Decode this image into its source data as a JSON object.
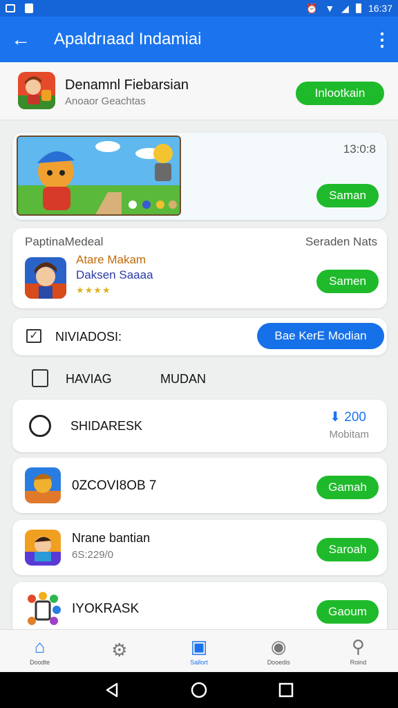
{
  "status_bar": {
    "time": "16:37"
  },
  "app_bar": {
    "title": "Apaldrıaad Indamiai"
  },
  "top_item": {
    "name": "Denamnl Fiebarsian",
    "subtitle": "Anoaor Geachtas",
    "button": "Inlootkain"
  },
  "banner": {
    "count": "13:0:8",
    "button": "Saman"
  },
  "popular": {
    "header_left": "PaptinaMedeal",
    "header_right": "Seraden Nats",
    "title": "Atare Makam",
    "subtitle": "Daksen Saaaa",
    "stars": "★★★★",
    "button": "Samen"
  },
  "section_row": {
    "label": "NIVIADOSI:",
    "button": "Bae KerE Modian"
  },
  "tabs": {
    "first": "HAVIAG",
    "second": "MUDAN"
  },
  "downloads": {
    "label": "SHIDARESK",
    "count": "200",
    "caption": "Mobitam"
  },
  "list": [
    {
      "title": "0ZCOVI8OB 7",
      "subtitle": "",
      "button": "Gamah"
    },
    {
      "title": "Nrane bantian",
      "subtitle": "6S:229/0",
      "button": "Saroah"
    },
    {
      "title": "IYOKRASK",
      "subtitle": "",
      "button": "Gaoum"
    }
  ],
  "bottom_nav": [
    {
      "label": "Doodte",
      "icon": "home-icon"
    },
    {
      "label": "",
      "icon": "settings-gear-icon"
    },
    {
      "label": "Sallort",
      "icon": "briefcase-icon"
    },
    {
      "label": "Dooedis",
      "icon": "bowling-icon"
    },
    {
      "label": "Roind",
      "icon": "person-icon"
    }
  ],
  "colors": {
    "primary": "#1b74ee",
    "status": "#1565d8",
    "green": "#1fba2b"
  }
}
